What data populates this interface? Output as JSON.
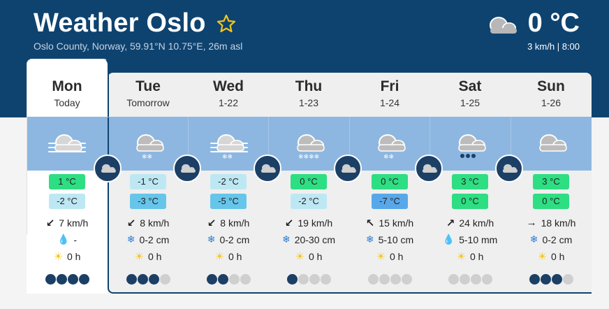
{
  "header": {
    "title": "Weather Oslo",
    "subtitle": "Oslo County, Norway, 59.91°N 10.75°E, 26m asl",
    "current_temp": "0 °C",
    "current_wind": "3 km/h",
    "current_time": "| 8:00",
    "current_icon": "cloud-icon",
    "favorite_icon": "star-outline-icon"
  },
  "colors": {
    "header_bg": "#0e4370",
    "band_bg": "#8db7e0",
    "max_green": "#2ede82",
    "min_light": "#bde8f3",
    "min_mid": "#67c5ea",
    "min_blue": "#58a8e9"
  },
  "days": [
    {
      "name": "Mon",
      "sub": "Today",
      "max": "1 °C",
      "min": "-2 °C",
      "wind": "7 km/h",
      "wind_dir": "sw",
      "precip": "-",
      "precip_icon": "drop-icon",
      "sun": "0 h",
      "sun_scores": [
        1,
        1,
        1,
        1
      ]
    },
    {
      "name": "Tue",
      "sub": "Tomorrow",
      "max": "-1 °C",
      "min": "-3 °C",
      "wind": "8 km/h",
      "wind_dir": "sw",
      "precip": "0-2 cm",
      "precip_icon": "snowflake-icon",
      "sun": "0 h",
      "sun_scores": [
        1,
        1,
        1,
        0
      ]
    },
    {
      "name": "Wed",
      "sub": "1-22",
      "max": "-2 °C",
      "min": "-5 °C",
      "wind": "8 km/h",
      "wind_dir": "sw",
      "precip": "0-2 cm",
      "precip_icon": "snowflake-icon",
      "sun": "0 h",
      "sun_scores": [
        1,
        1,
        0,
        0
      ]
    },
    {
      "name": "Thu",
      "sub": "1-23",
      "max": "0 °C",
      "min": "-2 °C",
      "wind": "19 km/h",
      "wind_dir": "sw",
      "precip": "20-30 cm",
      "precip_icon": "snowflake-icon",
      "sun": "0 h",
      "sun_scores": [
        1,
        0,
        0,
        0
      ]
    },
    {
      "name": "Fri",
      "sub": "1-24",
      "max": "0 °C",
      "min": "-7 °C",
      "wind": "15 km/h",
      "wind_dir": "nw",
      "precip": "5-10 cm",
      "precip_icon": "snowflake-icon",
      "sun": "0 h",
      "sun_scores": [
        0,
        0,
        0,
        0
      ]
    },
    {
      "name": "Sat",
      "sub": "1-25",
      "max": "3 °C",
      "min": "0 °C",
      "wind": "24 km/h",
      "wind_dir": "ne",
      "precip": "5-10 mm",
      "precip_icon": "drop-icon",
      "sun": "0 h",
      "sun_scores": [
        0,
        0,
        0,
        0
      ]
    },
    {
      "name": "Sun",
      "sub": "1-26",
      "max": "3 °C",
      "min": "0 °C",
      "wind": "18 km/h",
      "wind_dir": "e",
      "precip": "0-2 cm",
      "precip_icon": "snowflake-icon",
      "sun": "0 h",
      "sun_scores": [
        1,
        1,
        1,
        0
      ]
    }
  ]
}
